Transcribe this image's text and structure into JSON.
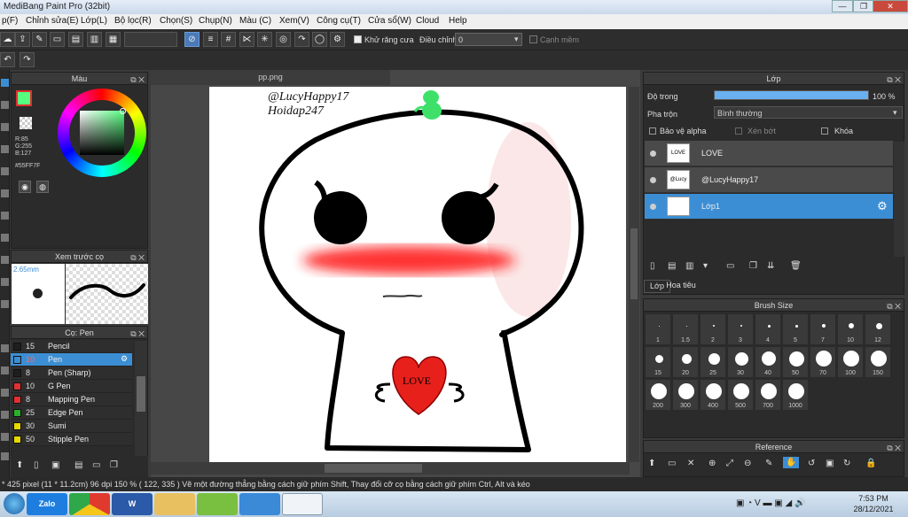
{
  "window": {
    "title": "MediBang Paint Pro (32bit)",
    "min": "—",
    "max": "❐",
    "close": "✕"
  },
  "menu": [
    "p(F)",
    "Chỉnh sửa(E)",
    "Lớp(L)",
    "Bộ lọc(R)",
    "Chọn(S)",
    "Chụp(N)",
    "Màu (C)",
    "Xem(V)",
    "Công cụ(T)",
    "Cửa sổ(W)",
    "Cloud",
    "Help"
  ],
  "toolbar": {
    "antialias_label": "Khử răng cưa",
    "adjust_label": "Điều chỉnh",
    "adjust_value": "0",
    "edge_label": "Cạnh mềm"
  },
  "color_panel": {
    "title": "Màu",
    "r": "R:85",
    "g": "G:255",
    "b": "B:127",
    "hex": "#55FF7F",
    "swatch": "#55FF7F"
  },
  "brush_preview": {
    "title": "Xem trước cọ",
    "size": "2.65mm"
  },
  "brush_panel": {
    "title": "Cọ: Pen",
    "items": [
      {
        "size": "15",
        "name": "Pencil",
        "color": "#1e1e1e"
      },
      {
        "size": "10",
        "name": "Pen",
        "color": "#3c8ed4"
      },
      {
        "size": "8",
        "name": "Pen (Sharp)",
        "color": "#1e1e1e"
      },
      {
        "size": "10",
        "name": "G Pen",
        "color": "#e03030"
      },
      {
        "size": "8",
        "name": "Mapping Pen",
        "color": "#e03030"
      },
      {
        "size": "25",
        "name": "Edge Pen",
        "color": "#2ab02a"
      },
      {
        "size": "30",
        "name": "Sumi",
        "color": "#e8d800"
      },
      {
        "size": "50",
        "name": "Stipple Pen",
        "color": "#e8d800"
      }
    ]
  },
  "document": {
    "tab": "pp.png",
    "text1": "@LucyHappy17",
    "text2": "Hoidap247",
    "heart_text": "LOVE"
  },
  "layer_panel": {
    "title": "Lớp",
    "opacity_label": "Độ trong",
    "opacity_value": 100,
    "opacity_text": "100 %",
    "blend_label": "Pha trộn",
    "blend_value": "Bình thường",
    "protect_alpha": "Bảo vệ alpha",
    "clipping": "Xén bớt",
    "lock": "Khóa",
    "layers": [
      {
        "name": "LOVE",
        "thumb": "LOVE",
        "selected": false
      },
      {
        "name": "@LucyHappy17",
        "thumb": "@Lucy",
        "selected": false
      },
      {
        "name": "Lớp1",
        "thumb": "",
        "selected": true
      }
    ],
    "tabs": [
      "Lớp",
      "Hoa tiêu"
    ]
  },
  "brush_size_panel": {
    "title": "Brush Size",
    "sizes": [
      "1",
      "1.5",
      "2",
      "3",
      "4",
      "5",
      "7",
      "10",
      "12",
      "15",
      "20",
      "25",
      "30",
      "40",
      "50",
      "70",
      "100",
      "150",
      "200",
      "300",
      "400",
      "500",
      "700",
      "1000"
    ]
  },
  "reference_panel": {
    "title": "Reference"
  },
  "status": {
    "text": "* 425 pixel  (11 * 11.2cm)  96 dpi  150 %  ( 122, 335 )  Vẽ một đường thẳng bằng cách giữ phím Shift, Thay đổi cỡ cọ bằng cách giữ phím Ctrl, Alt và kéo"
  },
  "taskbar": {
    "time": "7:53 PM",
    "date": "28/12/2021",
    "apps": [
      "start",
      "Zalo",
      "chrome",
      "W",
      "explorer",
      "app",
      "ie",
      "medibang"
    ]
  },
  "colors": {
    "accent": "#3c8ed4",
    "panel": "#2b2b2b"
  }
}
